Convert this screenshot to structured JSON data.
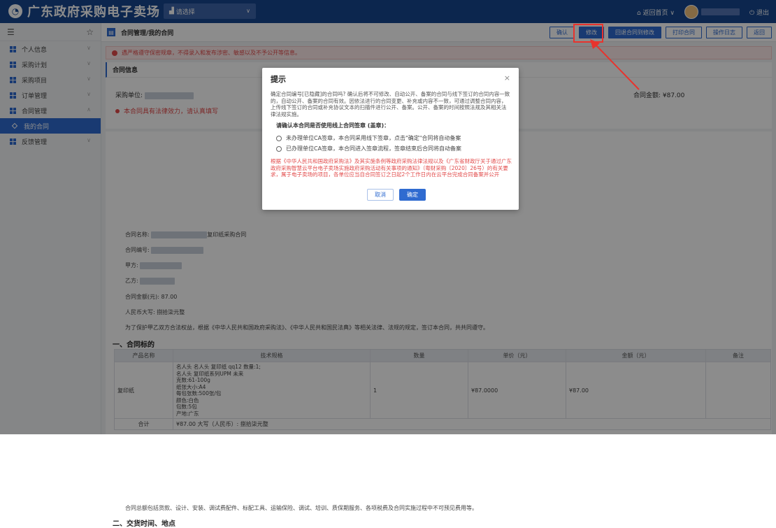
{
  "header": {
    "logo_text": "广东政府采购电子卖场",
    "region_label": "请选择",
    "back_home": "返回首页",
    "logout": "退出"
  },
  "sidebar": {
    "items": [
      {
        "label": "个人信息"
      },
      {
        "label": "采购计划"
      },
      {
        "label": "采购项目"
      },
      {
        "label": "订单管理"
      },
      {
        "label": "合同管理"
      },
      {
        "label": "反馈管理"
      }
    ],
    "sub_item": "我的合同"
  },
  "breadcrumb": "合同管理/我的合同",
  "actions": {
    "confirm": "确认",
    "edit": "修改",
    "rollback": "回退合同到修改",
    "print": "打印合同",
    "log": "操作日志",
    "back": "返回"
  },
  "alert_text": "遇严格遵守保密规章，不得录入和发布涉密、敏感以及不予公开等信息。",
  "info": {
    "title": "合同信息",
    "purchaser_label": "采购单位:",
    "amount": "合同金额: ¥87.00",
    "required_note": "本合同具有法律效力，请认真填写"
  },
  "contract": {
    "name_label": "合同名称:",
    "name_suffix": "复印纸采购合同",
    "no_label": "合同编号:",
    "party_a": "甲方:",
    "party_b": "乙方:",
    "amount_yuan": "合同金额(元): 87.00",
    "amount_upper": "人民币大写: 捌拾柒元整",
    "preamble": "为了保护甲乙双方合法权益，根据《中华人民共和国政府采购法》、《中华人民共和国民法典》等相关法律、法规的规定，签订本合同，共共同遵守。",
    "section1": "一、合同标的",
    "section2": "二、交货时间、地点",
    "footer_note": "合同总额包括货款、设计、安装、调试费配件、标配工具、运输保险、调试、培训、质保期服务、各项税费及合同实施过程中不可预见费用等。"
  },
  "table": {
    "headers": [
      "产品名称",
      "技术规格",
      "数量",
      "单价（元）",
      "金额（元）",
      "备注"
    ],
    "row": {
      "name": "复印纸",
      "spec": [
        "名人头 名人头 复印纸 qq12 数量:1;",
        "名人头 复印纸系列UPM 未来",
        "克数:61-100g",
        "纸张大小:A4",
        "每包张数:500张/包",
        "颜色:白色",
        "包数:5包",
        "产地:广东"
      ],
      "qty": "1",
      "unit_price": "¥87.0000",
      "total": "¥87.00",
      "remark": ""
    },
    "sum_label": "合计",
    "sum_value": "¥87.00 大写（人民币）: 捌拾柒元整"
  },
  "modal": {
    "title": "提示",
    "body": "确定合同编号[已隐藏]的合同吗? 确认后将不可修改、自动公开、备案的合同与线下签订的合同内容一致的，自动公开、备案的合同有效。因依法进行的合同变更、补充或内容不一致，可通过调整合同内容，上传线下签订的合同或补充协议文本的扫描件进行公开、备案。公开、备案的时间按照法规及其相关法律法规实施。",
    "question": "请确认本合同是否使用线上合同签章 (盖章)：",
    "option1": "未办理单位CA签章，本合同采用线下签章，点击\"确定\"合同将自动备案",
    "option2": "已办理单位CA签章，本合同进入签章流程，签章结束后合同将自动备案",
    "legal": "根据《中华人民共和国政府采购法》及其实施条例等政府采购法律法规以及《广东省财政厅关于通过广东政府采购智慧云平台电子卖场实施政府采购活动有关事项的通知》（粤财采购〔2020〕26号）的有关要求，属于电子卖场的项目，各单位应当自合同签订之日起2个工作日内在云平台完成合同备案并公开",
    "cancel": "取消",
    "ok": "确定"
  }
}
